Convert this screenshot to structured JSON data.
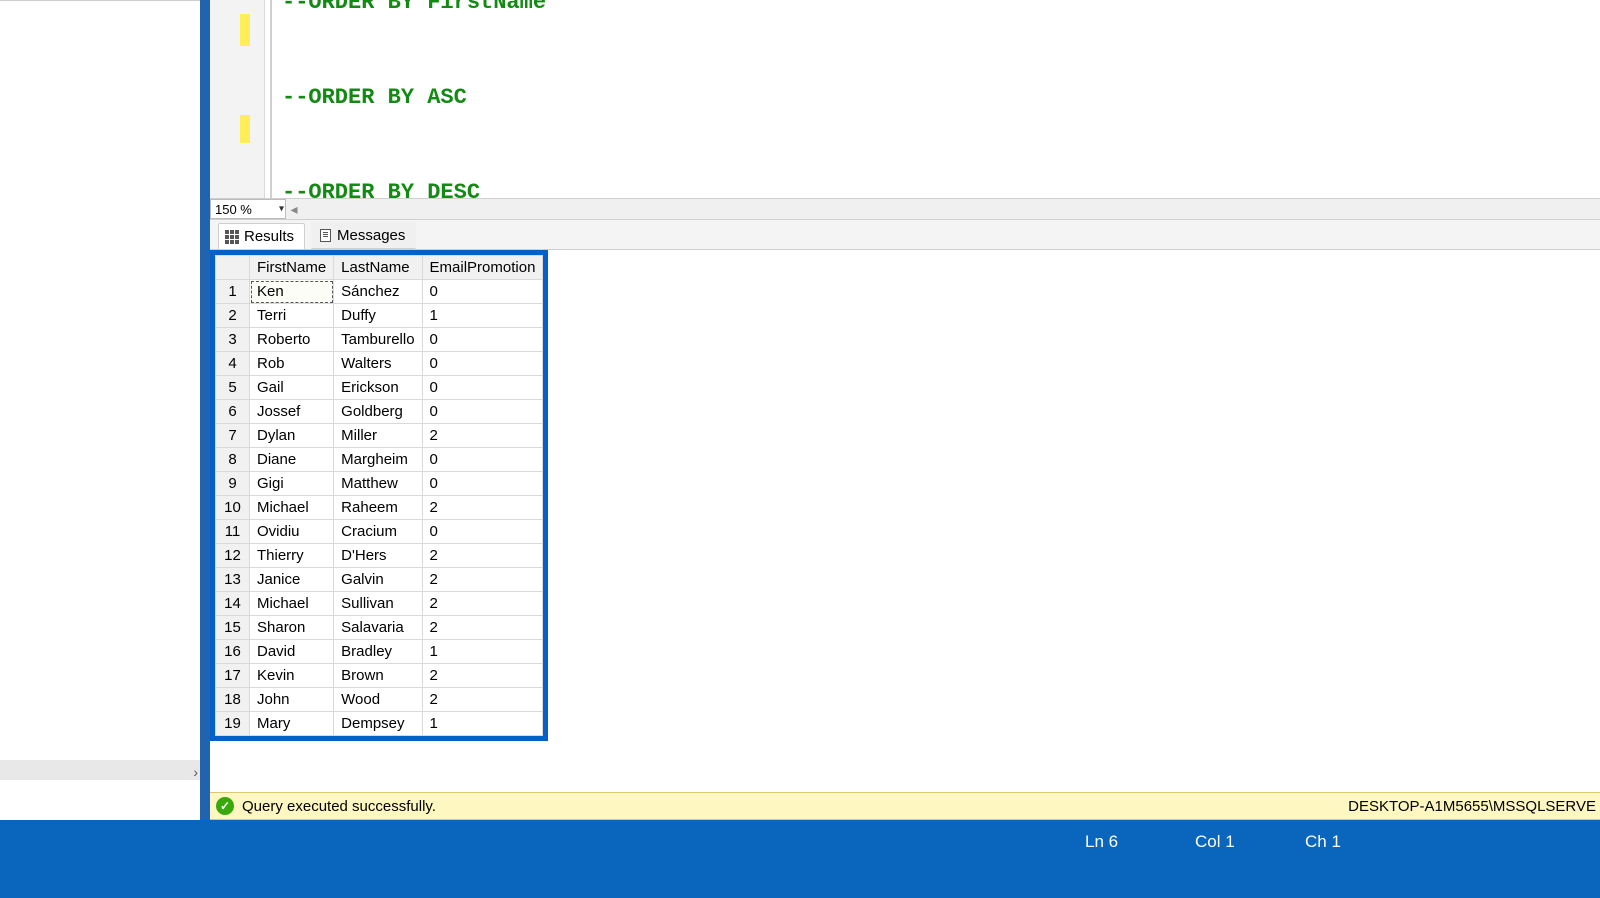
{
  "editor": {
    "line1": "--ORDER BY FirstName",
    "line2": "--ORDER BY ASC",
    "line3": "--ORDER BY DESC"
  },
  "zoom": {
    "level": "150 %"
  },
  "tabs": {
    "results": "Results",
    "messages": "Messages"
  },
  "grid": {
    "columns": [
      "FirstName",
      "LastName",
      "EmailPromotion"
    ],
    "rows": [
      {
        "n": "1",
        "fn": "Ken",
        "ln": "Sánchez",
        "ep": "0"
      },
      {
        "n": "2",
        "fn": "Terri",
        "ln": "Duffy",
        "ep": "1"
      },
      {
        "n": "3",
        "fn": "Roberto",
        "ln": "Tamburello",
        "ep": "0"
      },
      {
        "n": "4",
        "fn": "Rob",
        "ln": "Walters",
        "ep": "0"
      },
      {
        "n": "5",
        "fn": "Gail",
        "ln": "Erickson",
        "ep": "0"
      },
      {
        "n": "6",
        "fn": "Jossef",
        "ln": "Goldberg",
        "ep": "0"
      },
      {
        "n": "7",
        "fn": "Dylan",
        "ln": "Miller",
        "ep": "2"
      },
      {
        "n": "8",
        "fn": "Diane",
        "ln": "Margheim",
        "ep": "0"
      },
      {
        "n": "9",
        "fn": "Gigi",
        "ln": "Matthew",
        "ep": "0"
      },
      {
        "n": "10",
        "fn": "Michael",
        "ln": "Raheem",
        "ep": "2"
      },
      {
        "n": "11",
        "fn": "Ovidiu",
        "ln": "Cracium",
        "ep": "0"
      },
      {
        "n": "12",
        "fn": "Thierry",
        "ln": "D'Hers",
        "ep": "2"
      },
      {
        "n": "13",
        "fn": "Janice",
        "ln": "Galvin",
        "ep": "2"
      },
      {
        "n": "14",
        "fn": "Michael",
        "ln": "Sullivan",
        "ep": "2"
      },
      {
        "n": "15",
        "fn": "Sharon",
        "ln": "Salavaria",
        "ep": "2"
      },
      {
        "n": "16",
        "fn": "David",
        "ln": "Bradley",
        "ep": "1"
      },
      {
        "n": "17",
        "fn": "Kevin",
        "ln": "Brown",
        "ep": "2"
      },
      {
        "n": "18",
        "fn": "John",
        "ln": "Wood",
        "ep": "2"
      },
      {
        "n": "19",
        "fn": "Mary",
        "ln": "Dempsey",
        "ep": "1"
      }
    ]
  },
  "status": {
    "text": "Query executed successfully.",
    "server": "DESKTOP-A1M5655\\MSSQLSERVE"
  },
  "bottombar": {
    "ln": "Ln 6",
    "col": "Col 1",
    "ch": "Ch 1"
  }
}
